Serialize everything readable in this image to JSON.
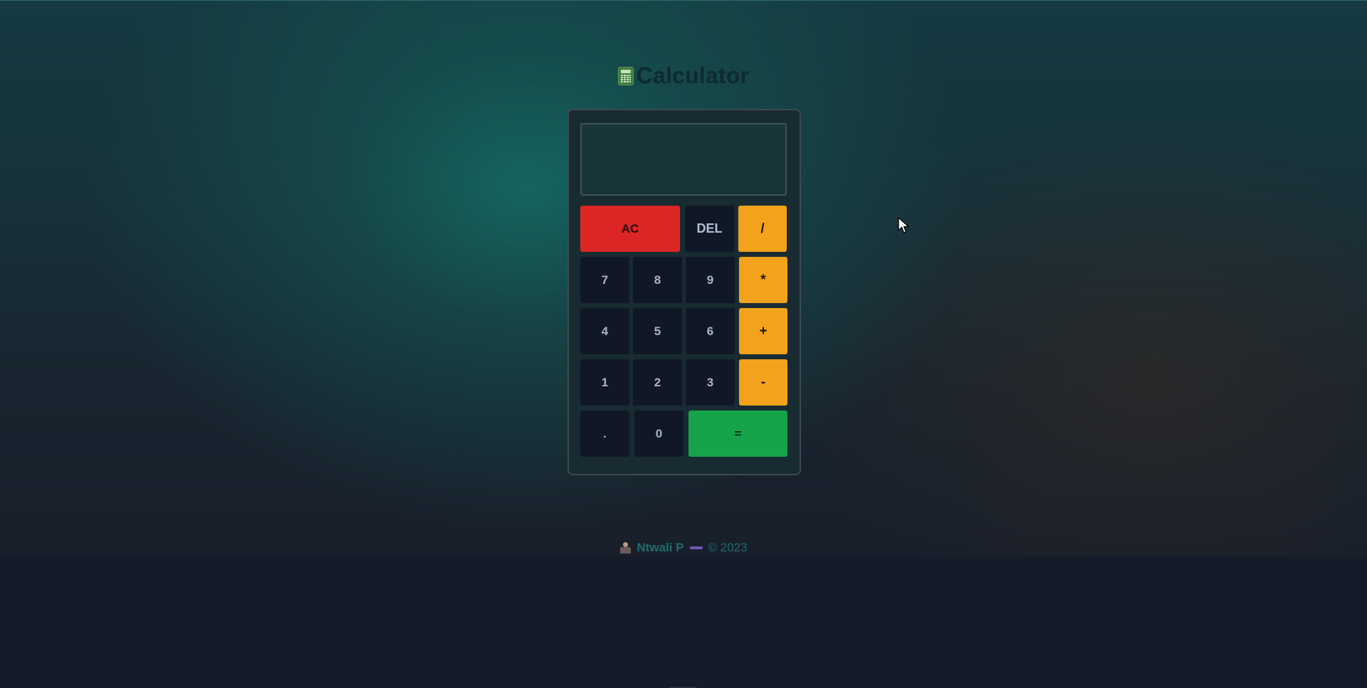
{
  "header": {
    "icon": "calculator-icon",
    "title": "Calculator"
  },
  "display": {
    "value": ""
  },
  "buttons": {
    "ac": "AC",
    "del": "DEL",
    "divide": "/",
    "seven": "7",
    "eight": "8",
    "nine": "9",
    "multiply": "*",
    "four": "4",
    "five": "5",
    "six": "6",
    "plus": "+",
    "one": "1",
    "two": "2",
    "three": "3",
    "minus": "-",
    "dot": ".",
    "zero": "0",
    "equals": "="
  },
  "footer": {
    "icon": "person-at-laptop-icon",
    "author": "Ntwali P",
    "copyright": "© 2023"
  },
  "colors": {
    "clear": "#dc2626",
    "operator": "#f3a21b",
    "equals": "#16a34a",
    "number": "#101726"
  }
}
